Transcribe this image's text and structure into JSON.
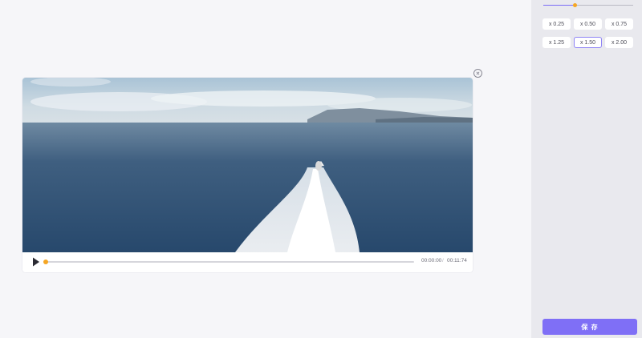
{
  "player": {
    "current_time": "00:00:00",
    "separator": "/",
    "total_time": "00:11:74",
    "progress": 0.0
  },
  "speed_panel": {
    "slider_value": 0.35,
    "options": [
      "x 0.25",
      "x 0.50",
      "x 0.75",
      "x 1.25",
      "x 1.50",
      "x 2.00"
    ],
    "selected": "x 1.50"
  },
  "actions": {
    "save_label": "保 存"
  },
  "icons": {
    "close": "close-circle-icon",
    "play": "play-icon",
    "camera": "camera-icon"
  },
  "colors": {
    "accent": "#7f6ff6",
    "knob": "#f5a623",
    "selected_border": "#8e83f5"
  }
}
